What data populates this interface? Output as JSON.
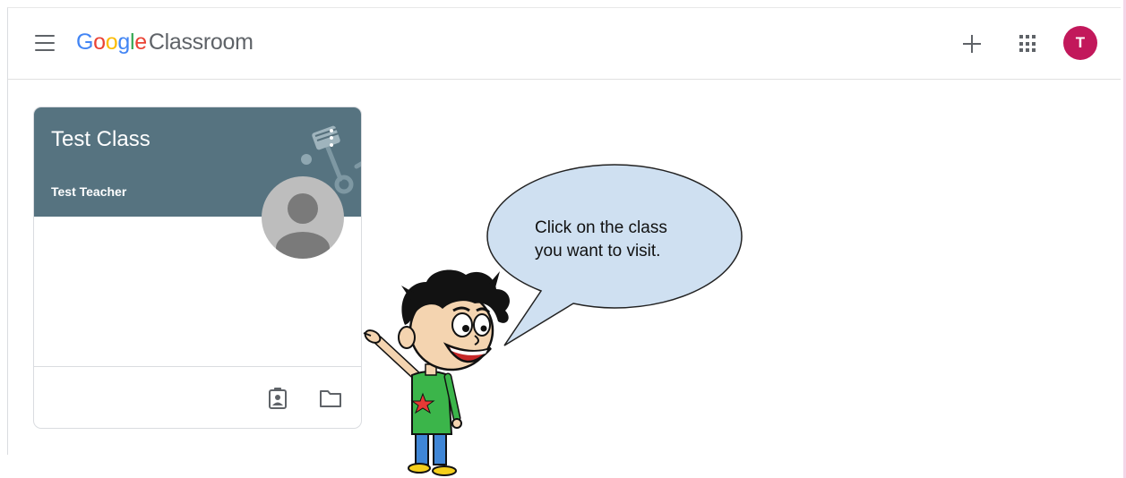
{
  "app": {
    "logo_google": [
      "G",
      "o",
      "o",
      "g",
      "l",
      "e"
    ],
    "product_name": "Classroom",
    "account_initial": "T"
  },
  "icons": {
    "menu": "hamburger-menu-icon",
    "create": "plus-icon",
    "apps": "apps-grid-icon",
    "more": "more-vert-icon",
    "assignments": "assignment-ind-icon",
    "folder": "folder-icon"
  },
  "colors": {
    "card_header": "#567380",
    "avatar": "#c2185b",
    "bubble": "#cfe0f1"
  },
  "class_card": {
    "title": "Test Class",
    "teacher": "Test Teacher"
  },
  "callout": {
    "line1": "Click on the class",
    "line2": "you want to visit."
  }
}
